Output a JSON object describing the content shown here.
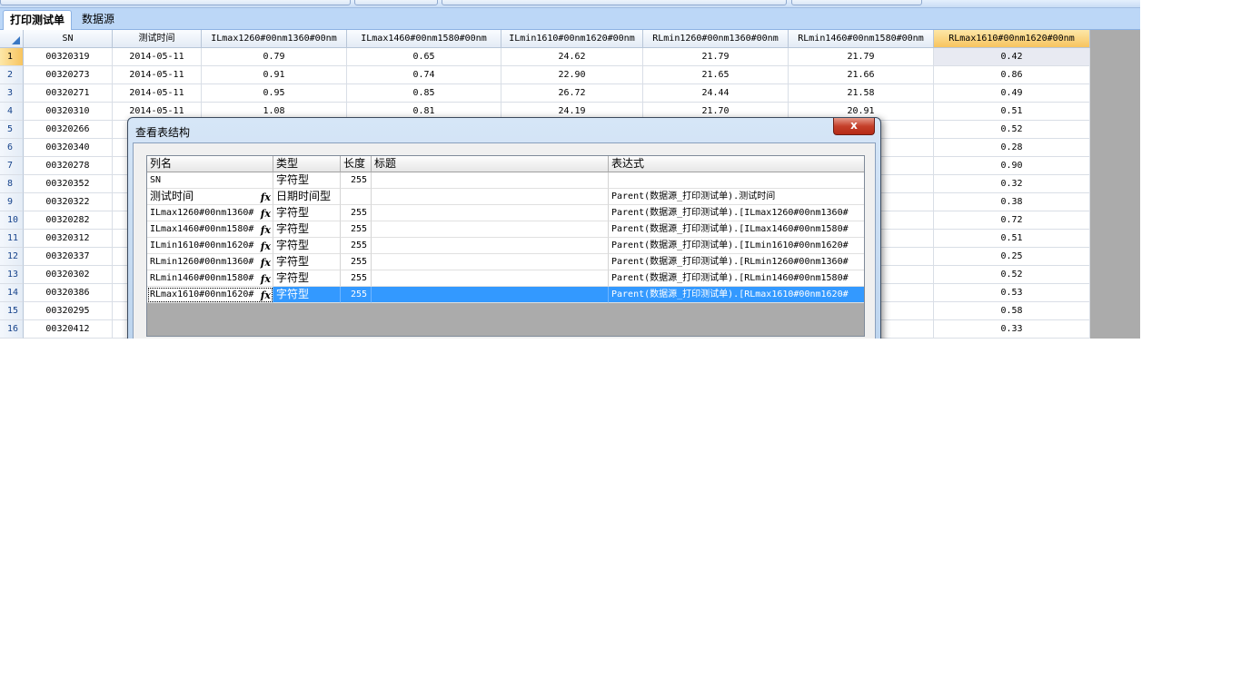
{
  "tabs": [
    {
      "label": "打印测试单",
      "active": true
    },
    {
      "label": "数据源",
      "active": false
    }
  ],
  "grid": {
    "headers": [
      "SN",
      "测试时间",
      "ILmax1260#00nm1360#00nm",
      "ILmax1460#00nm1580#00nm",
      "ILmin1610#00nm1620#00nm",
      "RLmin1260#00nm1360#00nm",
      "RLmin1460#00nm1580#00nm",
      "RLmax1610#00nm1620#00nm"
    ],
    "selected_column": 7,
    "rows": [
      {
        "n": "1",
        "cells": [
          "00320319",
          "2014-05-11",
          "0.79",
          "0.65",
          "24.62",
          "21.79",
          "21.79",
          "0.42"
        ]
      },
      {
        "n": "2",
        "cells": [
          "00320273",
          "2014-05-11",
          "0.91",
          "0.74",
          "22.90",
          "21.65",
          "21.66",
          "0.86"
        ]
      },
      {
        "n": "3",
        "cells": [
          "00320271",
          "2014-05-11",
          "0.95",
          "0.85",
          "26.72",
          "24.44",
          "21.58",
          "0.49"
        ]
      },
      {
        "n": "4",
        "cells": [
          "00320310",
          "2014-05-11",
          "1.08",
          "0.81",
          "24.19",
          "21.70",
          "20.91",
          "0.51"
        ]
      },
      {
        "n": "5",
        "cells": [
          "00320266",
          "",
          "",
          "",
          "",
          "",
          "",
          "0.52"
        ]
      },
      {
        "n": "6",
        "cells": [
          "00320340",
          "",
          "",
          "",
          "",
          "",
          "",
          "0.28"
        ]
      },
      {
        "n": "7",
        "cells": [
          "00320278",
          "",
          "",
          "",
          "",
          "",
          "",
          "0.90"
        ]
      },
      {
        "n": "8",
        "cells": [
          "00320352",
          "",
          "",
          "",
          "",
          "",
          "",
          "0.32"
        ]
      },
      {
        "n": "9",
        "cells": [
          "00320322",
          "",
          "",
          "",
          "",
          "",
          "",
          "0.38"
        ]
      },
      {
        "n": "10",
        "cells": [
          "00320282",
          "",
          "",
          "",
          "",
          "",
          "",
          "0.72"
        ]
      },
      {
        "n": "11",
        "cells": [
          "00320312",
          "",
          "",
          "",
          "",
          "",
          "",
          "0.51"
        ]
      },
      {
        "n": "12",
        "cells": [
          "00320337",
          "",
          "",
          "",
          "",
          "",
          "",
          "0.25"
        ]
      },
      {
        "n": "13",
        "cells": [
          "00320302",
          "",
          "",
          "",
          "",
          "",
          "",
          "0.52"
        ]
      },
      {
        "n": "14",
        "cells": [
          "00320386",
          "",
          "",
          "",
          "",
          "",
          "",
          "0.53"
        ]
      },
      {
        "n": "15",
        "cells": [
          "00320295",
          "",
          "",
          "",
          "",
          "",
          "",
          "0.58"
        ]
      },
      {
        "n": "16",
        "cells": [
          "00320412",
          "",
          "",
          "",
          "",
          "",
          "",
          "0.33"
        ]
      }
    ]
  },
  "dialog": {
    "title": "查看表结构",
    "close_label": "x",
    "columns": [
      "列名",
      "类型",
      "长度",
      "标题",
      "表达式"
    ],
    "fx_icon": "fx-icon",
    "rows": [
      {
        "name": "SN",
        "fx": false,
        "type": "字符型",
        "length": "255",
        "caption": "",
        "expr": ""
      },
      {
        "name": "测试时间",
        "fx": true,
        "type": "日期时间型",
        "length": "",
        "caption": "",
        "expr": "Parent(数据源_打印测试单).测试时间"
      },
      {
        "name": "ILmax1260#00nm1360#",
        "fx": true,
        "type": "字符型",
        "length": "255",
        "caption": "",
        "expr": "Parent(数据源_打印测试单).[ILmax1260#00nm1360#"
      },
      {
        "name": "ILmax1460#00nm1580#",
        "fx": true,
        "type": "字符型",
        "length": "255",
        "caption": "",
        "expr": "Parent(数据源_打印测试单).[ILmax1460#00nm1580#"
      },
      {
        "name": "ILmin1610#00nm1620#",
        "fx": true,
        "type": "字符型",
        "length": "255",
        "caption": "",
        "expr": "Parent(数据源_打印测试单).[ILmin1610#00nm1620#"
      },
      {
        "name": "RLmin1260#00nm1360#",
        "fx": true,
        "type": "字符型",
        "length": "255",
        "caption": "",
        "expr": "Parent(数据源_打印测试单).[RLmin1260#00nm1360#"
      },
      {
        "name": "RLmin1460#00nm1580#",
        "fx": true,
        "type": "字符型",
        "length": "255",
        "caption": "",
        "expr": "Parent(数据源_打印测试单).[RLmin1460#00nm1580#"
      },
      {
        "name": "RLmax1610#00nm1620#",
        "fx": true,
        "type": "字符型",
        "length": "255",
        "caption": "",
        "expr": "Parent(数据源_打印测试单).[RLmax1610#00nm1620#"
      }
    ],
    "selected_row": 7
  }
}
